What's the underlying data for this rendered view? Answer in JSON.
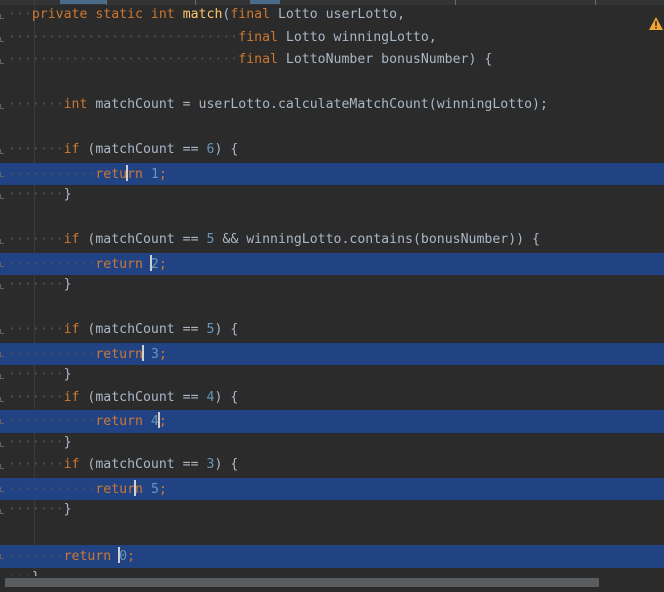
{
  "editor": {
    "indicator_colors": {
      "keyword": "#cc7832",
      "method": "#ffc66d",
      "number": "#6897bb",
      "text": "#a9b7c6",
      "selection": "#214283",
      "background": "#2b2b2b"
    },
    "warning_icon": "warning-icon",
    "lines": [
      {
        "ws": "···",
        "parts": [
          [
            "kw",
            "private static int "
          ],
          [
            "fn",
            "match"
          ],
          [
            "txt",
            "("
          ],
          [
            "kw",
            "final "
          ],
          [
            "txt",
            "Lotto userLotto,"
          ]
        ]
      },
      {
        "ws": "·····························",
        "parts": [
          [
            "kw",
            "final "
          ],
          [
            "txt",
            "Lotto winningLotto,"
          ]
        ]
      },
      {
        "ws": "·····························",
        "parts": [
          [
            "kw",
            "final "
          ],
          [
            "txt",
            "LottoNumber bonusNumber) {"
          ]
        ]
      },
      {
        "ws": "",
        "parts": []
      },
      {
        "ws": "·······",
        "parts": [
          [
            "kw",
            "int "
          ],
          [
            "txt",
            "matchCount = userLotto.calculateMatchCount(winningLotto);"
          ]
        ]
      },
      {
        "ws": "",
        "parts": []
      },
      {
        "ws": "·······",
        "parts": [
          [
            "kw",
            "if "
          ],
          [
            "txt",
            "(matchCount == "
          ],
          [
            "num",
            "6"
          ],
          [
            "txt",
            ") {"
          ]
        ]
      },
      {
        "ws": "···········",
        "sel": true,
        "parts": [
          [
            "kw",
            "retu"
          ],
          [
            "caret",
            ""
          ],
          [
            "kw",
            "rn "
          ],
          [
            "num",
            "1"
          ],
          [
            "kw",
            ";"
          ]
        ]
      },
      {
        "ws": "·······",
        "parts": [
          [
            "txt",
            "}"
          ]
        ]
      },
      {
        "ws": "",
        "parts": []
      },
      {
        "ws": "·······",
        "parts": [
          [
            "kw",
            "if "
          ],
          [
            "txt",
            "(matchCount == "
          ],
          [
            "num",
            "5"
          ],
          [
            "txt",
            " && winningLotto.contains(bonusNumber)) {"
          ]
        ]
      },
      {
        "ws": "···········",
        "sel": true,
        "parts": [
          [
            "kw",
            "return "
          ],
          [
            "caret",
            ""
          ],
          [
            "num",
            "2"
          ],
          [
            "kw",
            ";"
          ]
        ]
      },
      {
        "ws": "·······",
        "parts": [
          [
            "txt",
            "}"
          ]
        ]
      },
      {
        "ws": "",
        "parts": []
      },
      {
        "ws": "·······",
        "parts": [
          [
            "kw",
            "if "
          ],
          [
            "txt",
            "(matchCount == "
          ],
          [
            "num",
            "5"
          ],
          [
            "txt",
            ") {"
          ]
        ]
      },
      {
        "ws": "···········",
        "sel": true,
        "parts": [
          [
            "kw",
            "return"
          ],
          [
            "caret",
            ""
          ],
          [
            "kw",
            " "
          ],
          [
            "num",
            "3"
          ],
          [
            "kw",
            ";"
          ]
        ]
      },
      {
        "ws": "·······",
        "parts": [
          [
            "txt",
            "}"
          ]
        ]
      },
      {
        "ws": "·······",
        "parts": [
          [
            "kw",
            "if "
          ],
          [
            "txt",
            "(matchCount == "
          ],
          [
            "num",
            "4"
          ],
          [
            "txt",
            ") {"
          ]
        ]
      },
      {
        "ws": "···········",
        "sel": true,
        "parts": [
          [
            "kw",
            "return "
          ],
          [
            "num",
            "4"
          ],
          [
            "caret",
            ""
          ],
          [
            "kw",
            ";"
          ]
        ]
      },
      {
        "ws": "·······",
        "parts": [
          [
            "txt",
            "}"
          ]
        ]
      },
      {
        "ws": "·······",
        "parts": [
          [
            "kw",
            "if "
          ],
          [
            "txt",
            "(matchCount == "
          ],
          [
            "num",
            "3"
          ],
          [
            "txt",
            ") {"
          ]
        ]
      },
      {
        "ws": "···········",
        "sel": true,
        "parts": [
          [
            "kw",
            "retur"
          ],
          [
            "caret",
            ""
          ],
          [
            "kw",
            "n "
          ],
          [
            "num",
            "5"
          ],
          [
            "kw",
            ";"
          ]
        ]
      },
      {
        "ws": "·······",
        "parts": [
          [
            "txt",
            "}"
          ]
        ]
      },
      {
        "ws": "",
        "parts": []
      },
      {
        "ws": "·······",
        "sel": true,
        "parts": [
          [
            "kw",
            "return "
          ],
          [
            "caret",
            ""
          ],
          [
            "num",
            "0"
          ],
          [
            "kw",
            ";"
          ]
        ]
      },
      {
        "ws": "···",
        "parts": [
          [
            "txt",
            "}"
          ]
        ]
      }
    ]
  }
}
